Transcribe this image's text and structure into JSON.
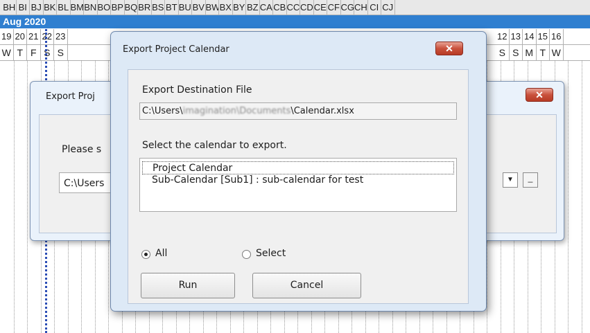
{
  "sheet": {
    "columns": [
      "BH",
      "BI",
      "BJ",
      "BK",
      "BL",
      "BM",
      "BN",
      "BO",
      "BP",
      "BQ",
      "BR",
      "BS",
      "BT",
      "BU",
      "BV",
      "BW",
      "BX",
      "BY",
      "BZ",
      "CA",
      "CB",
      "CC",
      "CD",
      "CE",
      "CF",
      "CG",
      "CH",
      "CI",
      "CJ"
    ],
    "month_label": "Aug 2020",
    "days_left": [
      "19",
      "20",
      "21",
      "22",
      "23"
    ],
    "weekdays_left": [
      "W",
      "T",
      "F",
      "S",
      "S"
    ],
    "days_right": [
      "12",
      "13",
      "14",
      "15",
      "16"
    ],
    "weekdays_right": [
      "S",
      "S",
      "M",
      "T",
      "W"
    ]
  },
  "back_dialog": {
    "title": "Export Proj",
    "prompt": "Please s",
    "path_value": "C:\\Users",
    "dropdown_glyph": "▼",
    "browse_glyph": "_",
    "close_glyph": "✕"
  },
  "dialog": {
    "title": "Export Project Calendar",
    "close_glyph": "✕",
    "dest_label": "Export Destination File",
    "dest_path_prefix": "C:\\Users\\",
    "dest_path_blurred": "imagination\\Documents",
    "dest_path_suffix": "\\Calendar.xlsx",
    "select_label": "Select the calendar to export.",
    "calendars": [
      "Project Calendar",
      "Sub-Calendar  [Sub1] : sub-calendar for test"
    ],
    "radio_all_label": "All",
    "radio_select_label": "Select",
    "selected_option": "All",
    "run_label": "Run",
    "cancel_label": "Cancel"
  }
}
